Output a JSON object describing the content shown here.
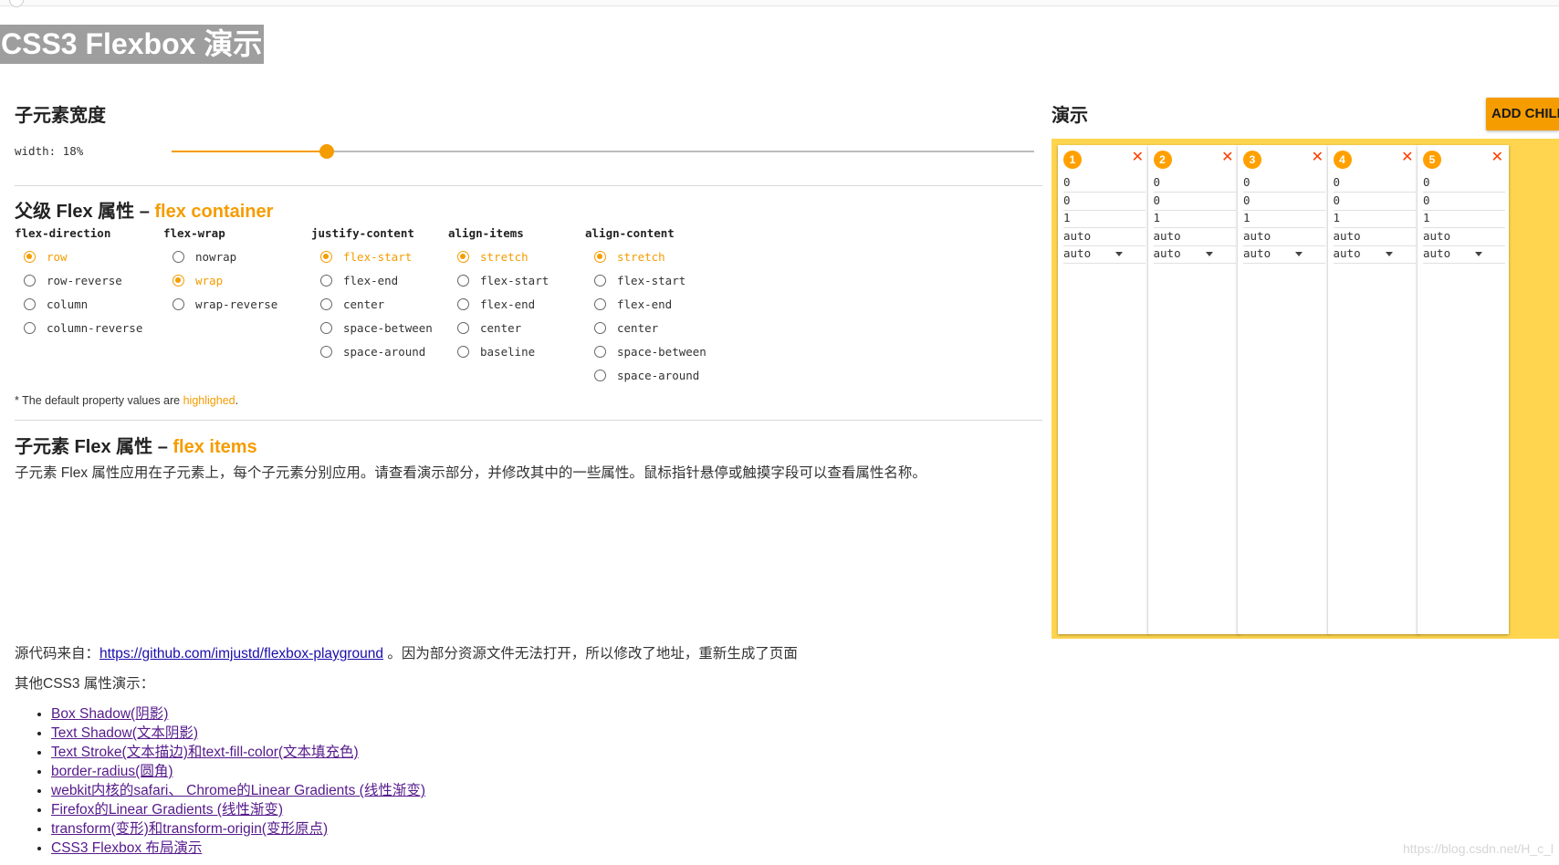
{
  "page_title": "CSS3 Flexbox 演示",
  "width_section": {
    "title": "子元素宽度",
    "label": "width: 18%",
    "value_percent": 18
  },
  "container_section": {
    "title": "父级 Flex 属性 – ",
    "title_accent": "flex container",
    "groups": [
      {
        "name": "flex-direction",
        "options": [
          "row",
          "row-reverse",
          "column",
          "column-reverse"
        ],
        "selected": 0
      },
      {
        "name": "flex-wrap",
        "options": [
          "nowrap",
          "wrap",
          "wrap-reverse"
        ],
        "selected": 1
      },
      {
        "name": "justify-content",
        "options": [
          "flex-start",
          "flex-end",
          "center",
          "space-between",
          "space-around"
        ],
        "selected": 0
      },
      {
        "name": "align-items",
        "options": [
          "stretch",
          "flex-start",
          "flex-end",
          "center",
          "baseline"
        ],
        "selected": 0
      },
      {
        "name": "align-content",
        "options": [
          "stretch",
          "flex-start",
          "flex-end",
          "center",
          "space-between",
          "space-around"
        ],
        "selected": 0
      }
    ],
    "note_prefix": "* The default property values are ",
    "note_accent": "highlighed",
    "note_suffix": "."
  },
  "items_section": {
    "title": "子元素 Flex 属性 – ",
    "title_accent": "flex items",
    "description": "子元素 Flex 属性应用在子元素上，每个子元素分别应用。请查看演示部分，并修改其中的一些属性。鼠标指针悬停或触摸字段可以查看属性名称。"
  },
  "source": {
    "prefix": "源代码来自：",
    "link": "https://github.com/imjustd/flexbox-playground",
    "suffix": " 。因为部分资源文件无法打开，所以修改了地址，重新生成了页面"
  },
  "other_label": "其他CSS3 属性演示：",
  "links": [
    "Box Shadow(阴影)",
    "Text Shadow(文本阴影)",
    "Text Stroke(文本描边)和text-fill-color(文本填充色)",
    "border-radius(圆角)",
    "webkit内核的safari、 Chrome的Linear Gradients (线性渐变)",
    "Firefox的Linear Gradients (线性渐变)",
    "transform(变形)和transform-origin(变形原点)",
    "CSS3 Flexbox 布局演示"
  ],
  "demo": {
    "title": "演示",
    "add_button": "ADD CHILD",
    "children": [
      {
        "badge": "1",
        "close": "✕",
        "order": "0",
        "grow": "0",
        "shrink": "1",
        "basis": "auto",
        "align_self": "auto"
      },
      {
        "badge": "2",
        "close": "✕",
        "order": "0",
        "grow": "0",
        "shrink": "1",
        "basis": "auto",
        "align_self": "auto"
      },
      {
        "badge": "3",
        "close": "✕",
        "order": "0",
        "grow": "0",
        "shrink": "1",
        "basis": "auto",
        "align_self": "auto"
      },
      {
        "badge": "4",
        "close": "✕",
        "order": "0",
        "grow": "0",
        "shrink": "1",
        "basis": "auto",
        "align_self": "auto"
      },
      {
        "badge": "5",
        "close": "✕",
        "order": "0",
        "grow": "0",
        "shrink": "1",
        "basis": "auto",
        "align_self": "auto"
      }
    ]
  },
  "watermark": "https://blog.csdn.net/H_c_l",
  "colors": {
    "accent": "#f59c00",
    "demo_bg": "#ffd54f",
    "badge": "#ffa000",
    "close": "#ff3d00",
    "title_bg": "#9e9e9e"
  }
}
